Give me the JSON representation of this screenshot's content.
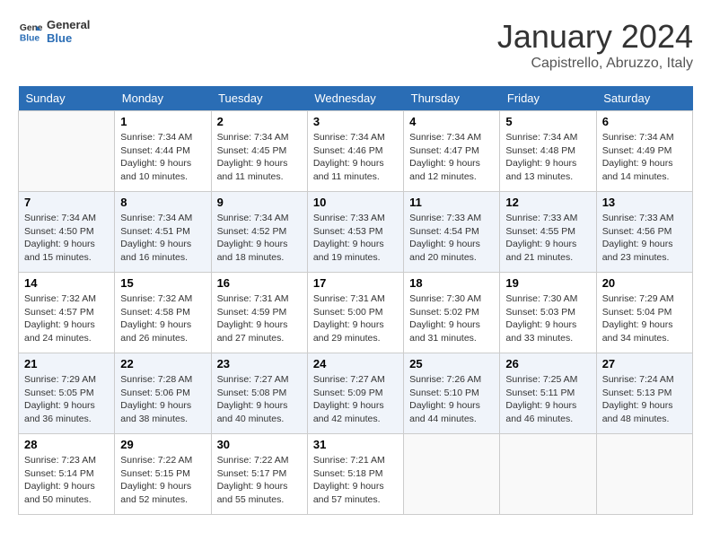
{
  "logo": {
    "line1": "General",
    "line2": "Blue"
  },
  "title": "January 2024",
  "location": "Capistrello, Abruzzo, Italy",
  "headers": [
    "Sunday",
    "Monday",
    "Tuesday",
    "Wednesday",
    "Thursday",
    "Friday",
    "Saturday"
  ],
  "weeks": [
    [
      {
        "day": "",
        "info": ""
      },
      {
        "day": "1",
        "info": "Sunrise: 7:34 AM\nSunset: 4:44 PM\nDaylight: 9 hours\nand 10 minutes."
      },
      {
        "day": "2",
        "info": "Sunrise: 7:34 AM\nSunset: 4:45 PM\nDaylight: 9 hours\nand 11 minutes."
      },
      {
        "day": "3",
        "info": "Sunrise: 7:34 AM\nSunset: 4:46 PM\nDaylight: 9 hours\nand 11 minutes."
      },
      {
        "day": "4",
        "info": "Sunrise: 7:34 AM\nSunset: 4:47 PM\nDaylight: 9 hours\nand 12 minutes."
      },
      {
        "day": "5",
        "info": "Sunrise: 7:34 AM\nSunset: 4:48 PM\nDaylight: 9 hours\nand 13 minutes."
      },
      {
        "day": "6",
        "info": "Sunrise: 7:34 AM\nSunset: 4:49 PM\nDaylight: 9 hours\nand 14 minutes."
      }
    ],
    [
      {
        "day": "7",
        "info": "Sunrise: 7:34 AM\nSunset: 4:50 PM\nDaylight: 9 hours\nand 15 minutes."
      },
      {
        "day": "8",
        "info": "Sunrise: 7:34 AM\nSunset: 4:51 PM\nDaylight: 9 hours\nand 16 minutes."
      },
      {
        "day": "9",
        "info": "Sunrise: 7:34 AM\nSunset: 4:52 PM\nDaylight: 9 hours\nand 18 minutes."
      },
      {
        "day": "10",
        "info": "Sunrise: 7:33 AM\nSunset: 4:53 PM\nDaylight: 9 hours\nand 19 minutes."
      },
      {
        "day": "11",
        "info": "Sunrise: 7:33 AM\nSunset: 4:54 PM\nDaylight: 9 hours\nand 20 minutes."
      },
      {
        "day": "12",
        "info": "Sunrise: 7:33 AM\nSunset: 4:55 PM\nDaylight: 9 hours\nand 21 minutes."
      },
      {
        "day": "13",
        "info": "Sunrise: 7:33 AM\nSunset: 4:56 PM\nDaylight: 9 hours\nand 23 minutes."
      }
    ],
    [
      {
        "day": "14",
        "info": "Sunrise: 7:32 AM\nSunset: 4:57 PM\nDaylight: 9 hours\nand 24 minutes."
      },
      {
        "day": "15",
        "info": "Sunrise: 7:32 AM\nSunset: 4:58 PM\nDaylight: 9 hours\nand 26 minutes."
      },
      {
        "day": "16",
        "info": "Sunrise: 7:31 AM\nSunset: 4:59 PM\nDaylight: 9 hours\nand 27 minutes."
      },
      {
        "day": "17",
        "info": "Sunrise: 7:31 AM\nSunset: 5:00 PM\nDaylight: 9 hours\nand 29 minutes."
      },
      {
        "day": "18",
        "info": "Sunrise: 7:30 AM\nSunset: 5:02 PM\nDaylight: 9 hours\nand 31 minutes."
      },
      {
        "day": "19",
        "info": "Sunrise: 7:30 AM\nSunset: 5:03 PM\nDaylight: 9 hours\nand 33 minutes."
      },
      {
        "day": "20",
        "info": "Sunrise: 7:29 AM\nSunset: 5:04 PM\nDaylight: 9 hours\nand 34 minutes."
      }
    ],
    [
      {
        "day": "21",
        "info": "Sunrise: 7:29 AM\nSunset: 5:05 PM\nDaylight: 9 hours\nand 36 minutes."
      },
      {
        "day": "22",
        "info": "Sunrise: 7:28 AM\nSunset: 5:06 PM\nDaylight: 9 hours\nand 38 minutes."
      },
      {
        "day": "23",
        "info": "Sunrise: 7:27 AM\nSunset: 5:08 PM\nDaylight: 9 hours\nand 40 minutes."
      },
      {
        "day": "24",
        "info": "Sunrise: 7:27 AM\nSunset: 5:09 PM\nDaylight: 9 hours\nand 42 minutes."
      },
      {
        "day": "25",
        "info": "Sunrise: 7:26 AM\nSunset: 5:10 PM\nDaylight: 9 hours\nand 44 minutes."
      },
      {
        "day": "26",
        "info": "Sunrise: 7:25 AM\nSunset: 5:11 PM\nDaylight: 9 hours\nand 46 minutes."
      },
      {
        "day": "27",
        "info": "Sunrise: 7:24 AM\nSunset: 5:13 PM\nDaylight: 9 hours\nand 48 minutes."
      }
    ],
    [
      {
        "day": "28",
        "info": "Sunrise: 7:23 AM\nSunset: 5:14 PM\nDaylight: 9 hours\nand 50 minutes."
      },
      {
        "day": "29",
        "info": "Sunrise: 7:22 AM\nSunset: 5:15 PM\nDaylight: 9 hours\nand 52 minutes."
      },
      {
        "day": "30",
        "info": "Sunrise: 7:22 AM\nSunset: 5:17 PM\nDaylight: 9 hours\nand 55 minutes."
      },
      {
        "day": "31",
        "info": "Sunrise: 7:21 AM\nSunset: 5:18 PM\nDaylight: 9 hours\nand 57 minutes."
      },
      {
        "day": "",
        "info": ""
      },
      {
        "day": "",
        "info": ""
      },
      {
        "day": "",
        "info": ""
      }
    ]
  ]
}
